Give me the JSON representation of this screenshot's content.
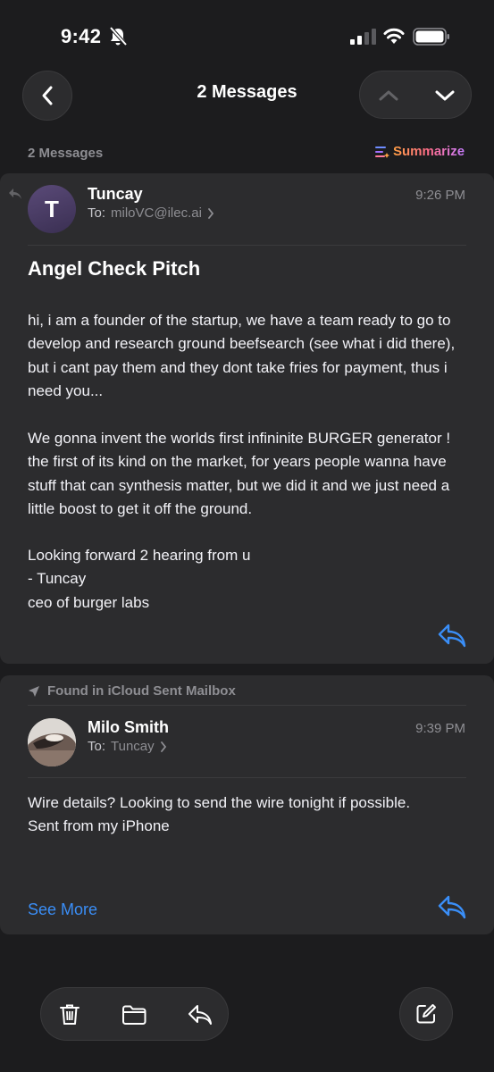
{
  "status": {
    "time": "9:42"
  },
  "nav": {
    "title": "2 Messages"
  },
  "thread": {
    "count_label": "2 Messages",
    "summarize_label": "Summarize"
  },
  "messages": [
    {
      "sender": "Tuncay",
      "avatar_initial": "T",
      "to_label": "To:",
      "to": "miloVC@ilec.ai",
      "time": "9:26 PM",
      "subject": "Angel Check Pitch",
      "paragraphs": [
        "hi, i am a founder of the startup, we have a team ready to go to develop and research ground beefsearch (see what i did there), but i cant pay them and they dont take fries for payment, thus i need you...",
        "We gonna invent the worlds first infininite BURGER generator ! the first of its kind on the market, for years people wanna have stuff that can synthesis matter, but we did it and we just need a little boost to get it off the ground.",
        "Looking forward 2 hearing from u\n- Tuncay\nceo of burger labs"
      ]
    },
    {
      "found_label": "Found in iCloud Sent Mailbox",
      "sender": "Milo Smith",
      "to_label": "To:",
      "to": "Tuncay",
      "time": "9:39 PM",
      "body": "Wire details? Looking to send the wire tonight if possible.\nSent from my iPhone",
      "see_more_label": "See More"
    }
  ],
  "colors": {
    "accent": "#3a8ef7",
    "background": "#1c1c1e",
    "card": "#2c2c2e",
    "secondary_text": "#8e8e93"
  },
  "icons": [
    "bell-slash-icon",
    "cellular-signal-icon",
    "wifi-icon",
    "battery-icon",
    "chevron-left-icon",
    "chevron-up-icon",
    "chevron-down-icon",
    "summarize-icon",
    "reply-icon",
    "paper-plane-icon",
    "trash-icon",
    "folder-icon",
    "compose-icon"
  ]
}
